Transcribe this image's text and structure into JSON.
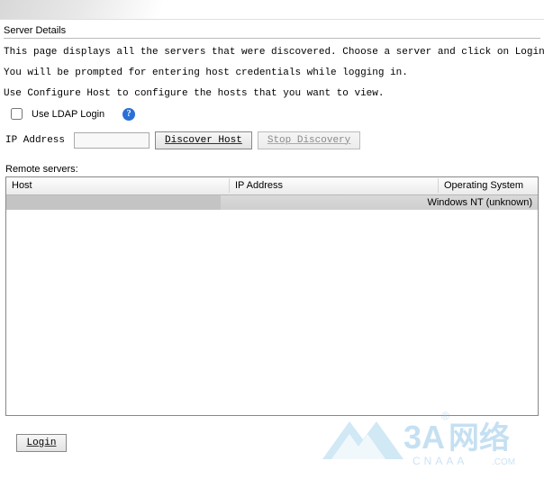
{
  "header": {
    "title": "Server Details"
  },
  "description": {
    "line1": "This page displays all the servers that were discovered. Choose a server and click on Login to start managing that serve",
    "line2": "You will be prompted for entering host credentials while logging in.",
    "line3": "Use Configure Host to configure the hosts that you want to view."
  },
  "ldap": {
    "label": "Use LDAP Login",
    "checked": false,
    "help_symbol": "?"
  },
  "ip": {
    "label": "IP Address",
    "value": ""
  },
  "buttons": {
    "discover": "Discover Host",
    "stop": "Stop Discovery",
    "login": "Login"
  },
  "remote": {
    "label": "Remote servers:",
    "columns": {
      "host": "Host",
      "ip": "IP Address",
      "os": "Operating System"
    },
    "rows": [
      {
        "host": "",
        "ip": "",
        "os": "Windows NT (unknown)"
      }
    ]
  },
  "watermark": {
    "brand_text": "3A网络",
    "brand_sub": "CNAAA.COM"
  }
}
